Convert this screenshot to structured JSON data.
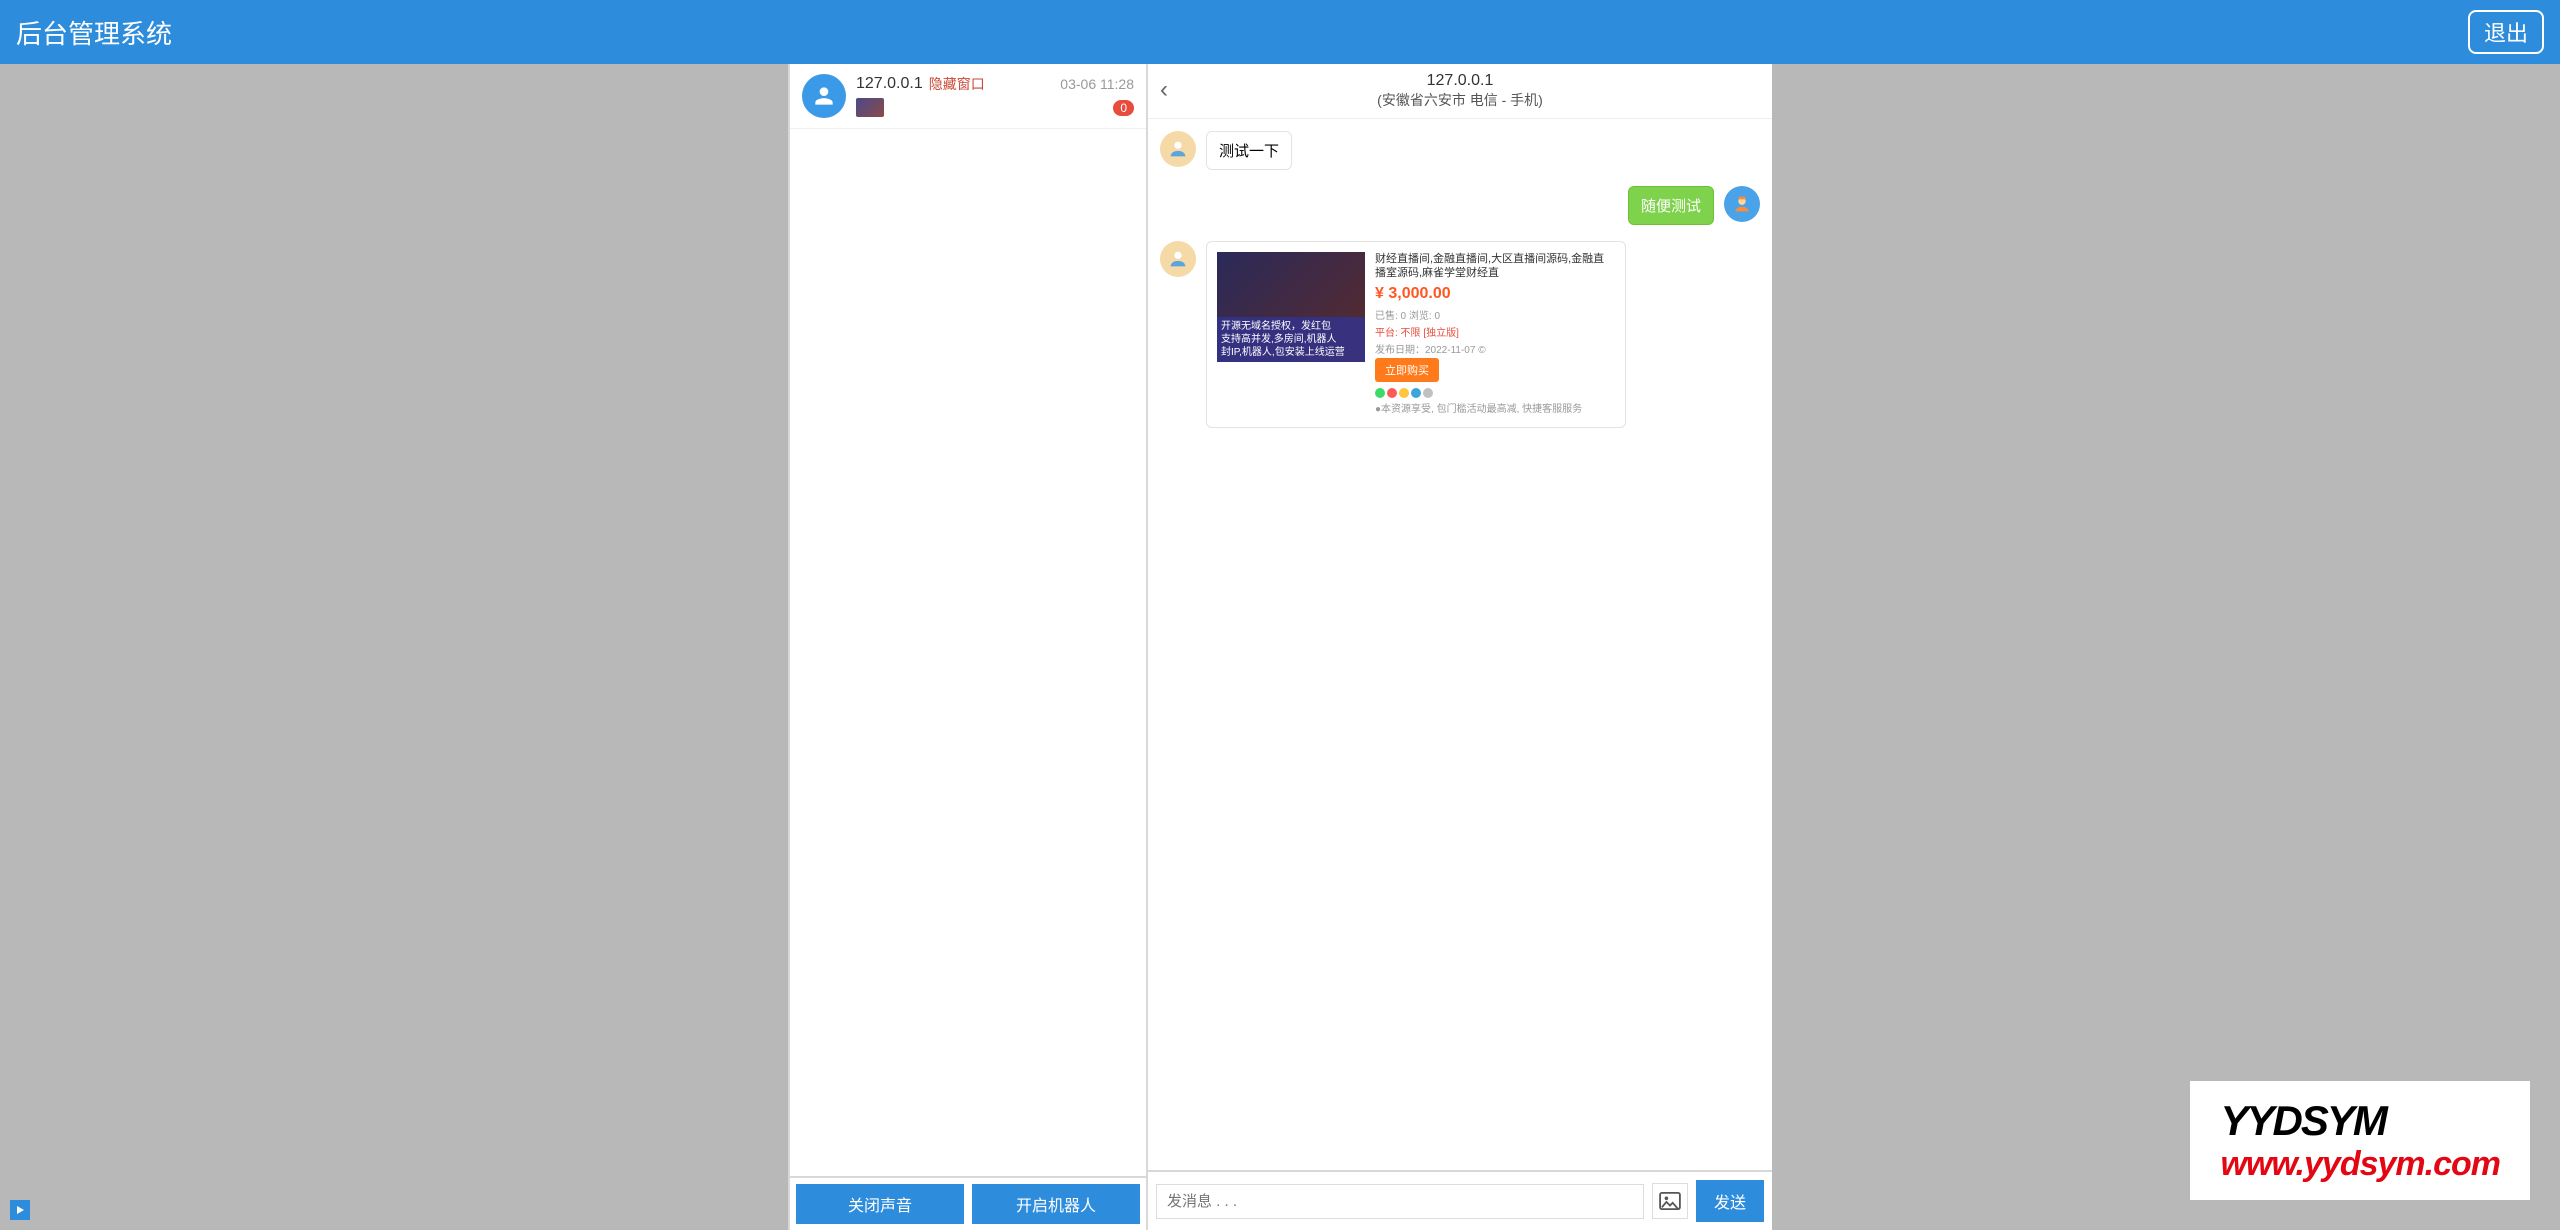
{
  "header": {
    "title": "后台管理系统",
    "logout": "退出"
  },
  "contact": {
    "name": "127.0.0.1",
    "hide_label": "隐藏窗口",
    "time": "03-06 11:28",
    "unread": "0"
  },
  "center_buttons": {
    "close_sound": "关闭声音",
    "start_bot": "开启机器人"
  },
  "chat": {
    "header_ip": "127.0.0.1",
    "header_loc": "(安徽省六安市 电信 - 手机)",
    "msg_in_1": "测试一下",
    "msg_out_1": "随便测试",
    "product": {
      "title": "财经直播间,金融直播间,大区直播间源码,金融直播室源码,麻雀学堂财经直",
      "price": "¥ 3,000.00",
      "meta1": "已售: 0    浏览: 0",
      "tags": "平台: 不限 [独立版]",
      "date_label": "发布日期：2022-11-07 ©",
      "btn": "立即购买",
      "footer1": "●本资源享受, 包门槛活动最高减, 快捷客服服务",
      "overlay1": "开源无域名授权，发红包",
      "overlay2": "支持高并发,多房间,机器人",
      "overlay3": "封IP,机器人,包安装上线运营"
    },
    "input_placeholder": "发消息 . . .",
    "send": "发送"
  },
  "watermark": {
    "line1": "YYDSYM",
    "line2": "www.yydsym.com"
  }
}
